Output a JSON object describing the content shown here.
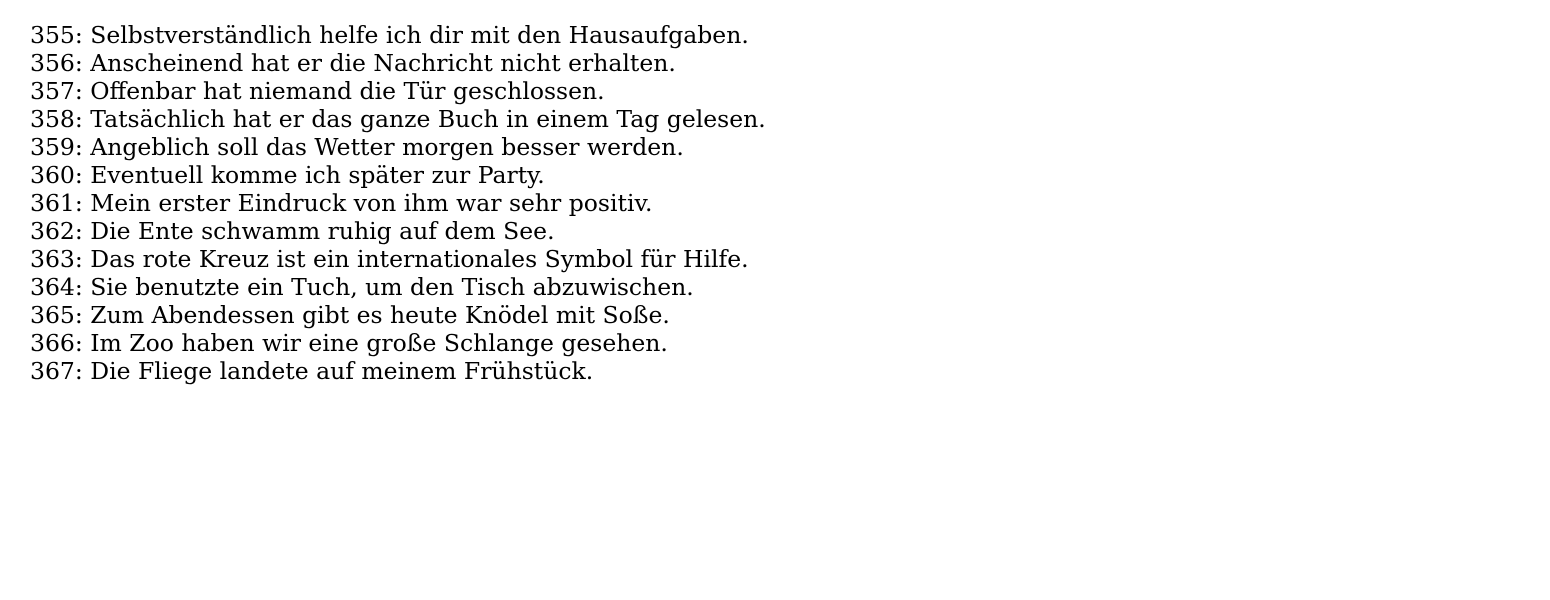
{
  "lines": [
    "355: Selbstverständlich helfe ich dir mit den Hausaufgaben.",
    "356: Anscheinend hat er die Nachricht nicht erhalten.",
    "357: Offenbar hat niemand die Tür geschlossen.",
    "358: Tatsächlich hat er das ganze Buch in einem Tag gelesen.",
    "359: Angeblich soll das Wetter morgen besser werden.",
    "360: Eventuell komme ich später zur Party.",
    "361: Mein erster Eindruck von ihm war sehr positiv.",
    "362: Die Ente schwamm ruhig auf dem See.",
    "363: Das rote Kreuz ist ein internationales Symbol für Hilfe.",
    "364: Sie benutzte ein Tuch, um den Tisch abzuwischen.",
    "365: Zum Abendessen gibt es heute Knödel mit Soße.",
    "366: Im Zoo haben wir eine große Schlange gesehen.",
    "367: Die Fliege landete auf meinem Frühstück."
  ]
}
